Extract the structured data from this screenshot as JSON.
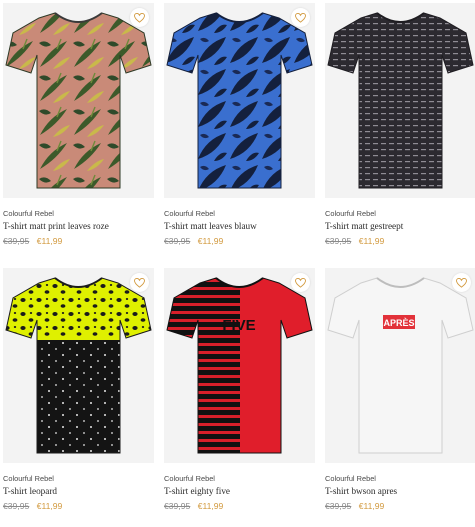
{
  "products": [
    {
      "brand": "Colourful Rebel",
      "title": "T-shirt matt print leaves roze",
      "old_price": "€39,95",
      "price": "€11,99",
      "wishlist_icon": "heart-icon"
    },
    {
      "brand": "Colourful Rebel",
      "title": "T-shirt matt leaves blauw",
      "old_price": "€39,95",
      "price": "€11,99",
      "wishlist_icon": "heart-icon"
    },
    {
      "brand": "Colourful Rebel",
      "title": "T-shirt matt gestreept",
      "old_price": "€39,95",
      "price": "€11,99",
      "wishlist_icon": "heart-icon"
    },
    {
      "brand": "Colourful Rebel",
      "title": "T-shirt leopard",
      "old_price": "€39,95",
      "price": "€11,99",
      "wishlist_icon": "heart-icon"
    },
    {
      "brand": "Colourful Rebel",
      "title": "T-shirt eighty five",
      "old_price": "€39,95",
      "price": "€11,99",
      "wishlist_icon": "heart-icon",
      "shirt_print": "FIVE"
    },
    {
      "brand": "Colourful Rebel",
      "title": "T-shirt bwson apres",
      "old_price": "€39,95",
      "price": "€11,99",
      "wishlist_icon": "heart-icon",
      "shirt_print": "APRÈS"
    }
  ],
  "colors": {
    "price_accent": "#d29a3f",
    "old_price": "#8a8a8a",
    "image_bg": "#f3f3f3"
  }
}
